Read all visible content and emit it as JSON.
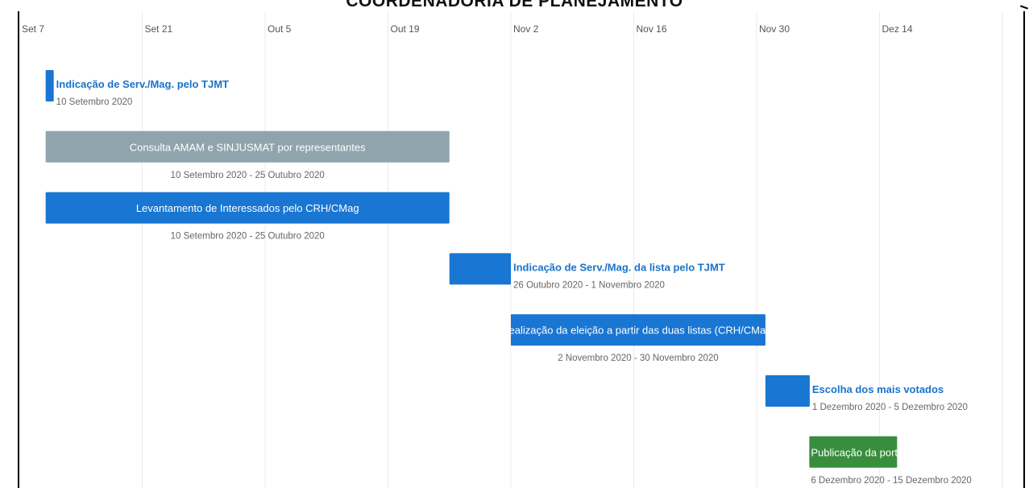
{
  "page": {
    "title": "COORDENADORIA DE PLANEJAMENTO"
  },
  "chart_data": {
    "type": "gantt",
    "x_axis": {
      "ticks": [
        "Set 7",
        "Set 21",
        "Out 5",
        "Out 19",
        "Nov 2",
        "Nov 16",
        "Nov 30",
        "Dez 14"
      ],
      "tick_dates": [
        "2020-09-07",
        "2020-09-21",
        "2020-10-05",
        "2020-10-19",
        "2020-11-02",
        "2020-11-16",
        "2020-11-30",
        "2020-12-14"
      ],
      "range": [
        "2020-09-07",
        "2020-12-28"
      ],
      "grid": true
    },
    "tasks": [
      {
        "name": "Indicação de Serv./Mag. pelo TJMT",
        "start": "2020-09-10",
        "end": "2020-09-10",
        "dates": "10 Setembro 2020",
        "color": "#1976d2",
        "label_position": "right"
      },
      {
        "name": "Consulta AMAM e SINJUSMAT por representantes",
        "start": "2020-09-10",
        "end": "2020-10-25",
        "dates": "10 Setembro 2020 - 25 Outubro 2020",
        "color": "#90a4ae",
        "label_position": "inside"
      },
      {
        "name": "Levantamento de Interessados pelo CRH/CMag",
        "start": "2020-09-10",
        "end": "2020-10-25",
        "dates": "10 Setembro 2020 - 25 Outubro 2020",
        "color": "#1976d2",
        "label_position": "inside"
      },
      {
        "name": "Indicação de Serv./Mag. da lista pelo TJMT",
        "start": "2020-10-26",
        "end": "2020-11-01",
        "dates": "26 Outubro 2020 - 1 Novembro 2020",
        "color": "#1976d2",
        "label_position": "right"
      },
      {
        "name": "Realização da eleição a partir das duas listas (CRH/CMag)",
        "start": "2020-11-02",
        "end": "2020-11-30",
        "dates": "2 Novembro 2020 - 30 Novembro 2020",
        "color": "#1976d2",
        "label_position": "inside"
      },
      {
        "name": "Escolha dos mais votados",
        "start": "2020-12-01",
        "end": "2020-12-05",
        "dates": "1 Dezembro 2020 - 5 Dezembro 2020",
        "color": "#1976d2",
        "label_position": "right"
      },
      {
        "name": "Publicação da portaria",
        "start": "2020-12-06",
        "end": "2020-12-15",
        "dates": "6 Dezembro 2020 - 15 Dezembro 2020",
        "color": "#388e3c",
        "label_position": "inside-left"
      }
    ]
  }
}
